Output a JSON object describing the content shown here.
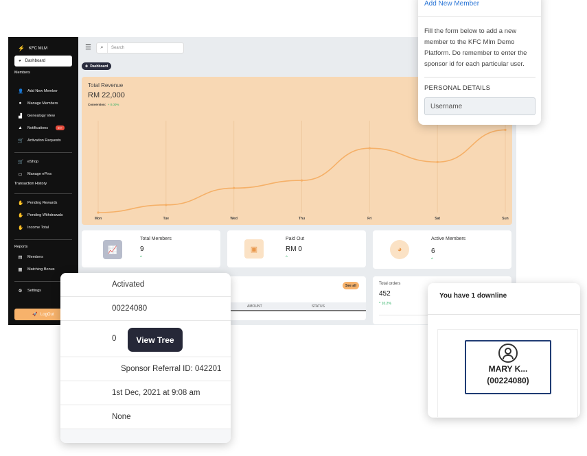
{
  "sidebar": {
    "brand": "KFC MLM",
    "active_item": "Dashboard",
    "members_heading": "Members",
    "items_members": [
      "Add New Member",
      "Manage Members",
      "Genealogy View",
      "Notifications",
      "Activation Requests"
    ],
    "notifications_badge": "99+",
    "items_shop": [
      "eShop",
      "Manage ePins"
    ],
    "transaction_heading": "Transaction History",
    "items_transactions": [
      "Pending Rewards",
      "Pending Withdrawals",
      "Income Total"
    ],
    "reports_heading": "Reports",
    "items_reports": [
      "Members",
      "Matching Bonus"
    ],
    "settings": "Settings",
    "logout": "LogOut"
  },
  "header": {
    "search_placeholder": "Search",
    "dashboard_button": "Dashboard"
  },
  "revenue": {
    "title": "Total Revenue",
    "value": "RM 22,000",
    "conversion_label": "Conversion:",
    "conversion_value": "+ 0.00%",
    "line_color": "#f5b068"
  },
  "chart_data": {
    "type": "line",
    "categories": [
      "Mon",
      "Tue",
      "Wed",
      "Thu",
      "Fri",
      "Sat",
      "Sun"
    ],
    "values": [
      0,
      5,
      16,
      21,
      42,
      33,
      54
    ],
    "ylim": [
      0,
      60
    ],
    "grid": "vertical"
  },
  "stats": {
    "total_members_label": "Total Members",
    "total_members_value": "9",
    "paid_out_label": "Paid Out",
    "paid_out_value": "RM 0",
    "active_members_label": "Active Members",
    "active_members_value": "6",
    "trend": "^"
  },
  "table_card": {
    "see_all": "See all",
    "col_amount": "AMOUNT",
    "col_status": "STATUS"
  },
  "orders_card": {
    "label": "Total orders",
    "value": "452",
    "change": "^ 10.2%"
  },
  "add_member": {
    "title": "Add New Member",
    "description": "Fill the form below to add a new member to the KFC Mlm Demo Platform. Do remember to enter the sponsor id for each particular user.",
    "section": "PERSONAL DETAILS",
    "username_placeholder": "Username"
  },
  "member_detail": {
    "status": "Activated",
    "member_id": "00224080",
    "downline_count": "0",
    "view_tree": "View Tree",
    "sponsor": "Sponsor Referral ID: 042201",
    "joined": "1st Dec, 2021 at 9:08 am",
    "extra": "None"
  },
  "downline": {
    "title": "You have 1 downline",
    "node_name": "MARY K...",
    "node_id": "(00224080)"
  }
}
